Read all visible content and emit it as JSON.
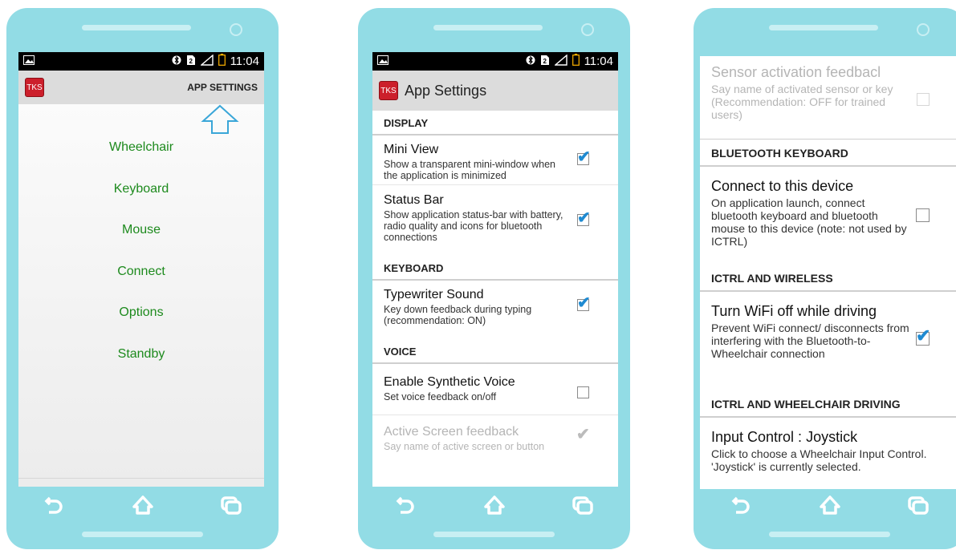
{
  "phone1": {
    "status_time": "11:04",
    "app_action": "APP SETTINGS",
    "logo_text": "TKS",
    "menu_items": [
      "Wheelchair",
      "Keyboard",
      "Mouse",
      "Connect",
      "Options",
      "Standby"
    ]
  },
  "phone2": {
    "status_time": "11:04",
    "logo_text": "TKS",
    "title": "App Settings",
    "sections": [
      {
        "header": "DISPLAY",
        "prefs": [
          {
            "title": "Mini View",
            "summary": "Show a transparent mini-window when the application is minimized",
            "checked": true
          },
          {
            "title": "Status Bar",
            "summary": "Show application status-bar with battery, radio quality and icons for bluetooth connections",
            "checked": true
          }
        ]
      },
      {
        "header": "KEYBOARD",
        "prefs": [
          {
            "title": "Typewriter Sound",
            "summary": "Key down feedback during typing (recommendation: ON)",
            "checked": true
          }
        ]
      },
      {
        "header": "VOICE",
        "prefs": [
          {
            "title": "Enable Synthetic Voice",
            "summary": "Set voice feedback on/off",
            "checked": false
          },
          {
            "title": "Active Screen feedback",
            "summary": "Say name of active screen or button",
            "checked": true,
            "disabled": true
          }
        ]
      }
    ]
  },
  "phone3": {
    "top_pref": {
      "title": "Sensor activation feedbacl",
      "summary": "Say name of activated sensor or key (Recommendation: OFF for trained users)",
      "checked": false,
      "disabled": true
    },
    "sections": [
      {
        "header": "BLUETOOTH KEYBOARD",
        "prefs": [
          {
            "title": "Connect to this device",
            "summary": "On application launch, connect bluetooth keyboard and bluetooth mouse to this device (note: not used by ICTRL)",
            "checked": false
          }
        ]
      },
      {
        "header": "ICTRL AND WIRELESS",
        "prefs": [
          {
            "title": "Turn WiFi off while driving",
            "summary": "Prevent WiFi connect/ disconnects from interfering with the Bluetooth-to-Wheelchair connection",
            "checked": true
          }
        ]
      },
      {
        "header": "ICTRL AND WHEELCHAIR DRIVING",
        "prefs": [
          {
            "title": "Input Control : Joystick",
            "summary": "Click to choose a Wheelchair Input Control. 'Joystick' is currently selected."
          }
        ]
      }
    ]
  },
  "icons": {
    "back": "back-arrow-icon",
    "home": "home-icon",
    "recent": "recent-apps-icon",
    "bluetooth": "bluetooth-icon",
    "sim": "sim-icon",
    "signal": "signal-icon",
    "battery": "battery-icon",
    "gallery": "gallery-icon",
    "up_arrow": "up-arrow-icon"
  },
  "colors": {
    "phone_body": "#92dce5",
    "menu_text": "#1d8a1d",
    "check": "#1f8ad1",
    "logo": "#cc1f2b"
  }
}
